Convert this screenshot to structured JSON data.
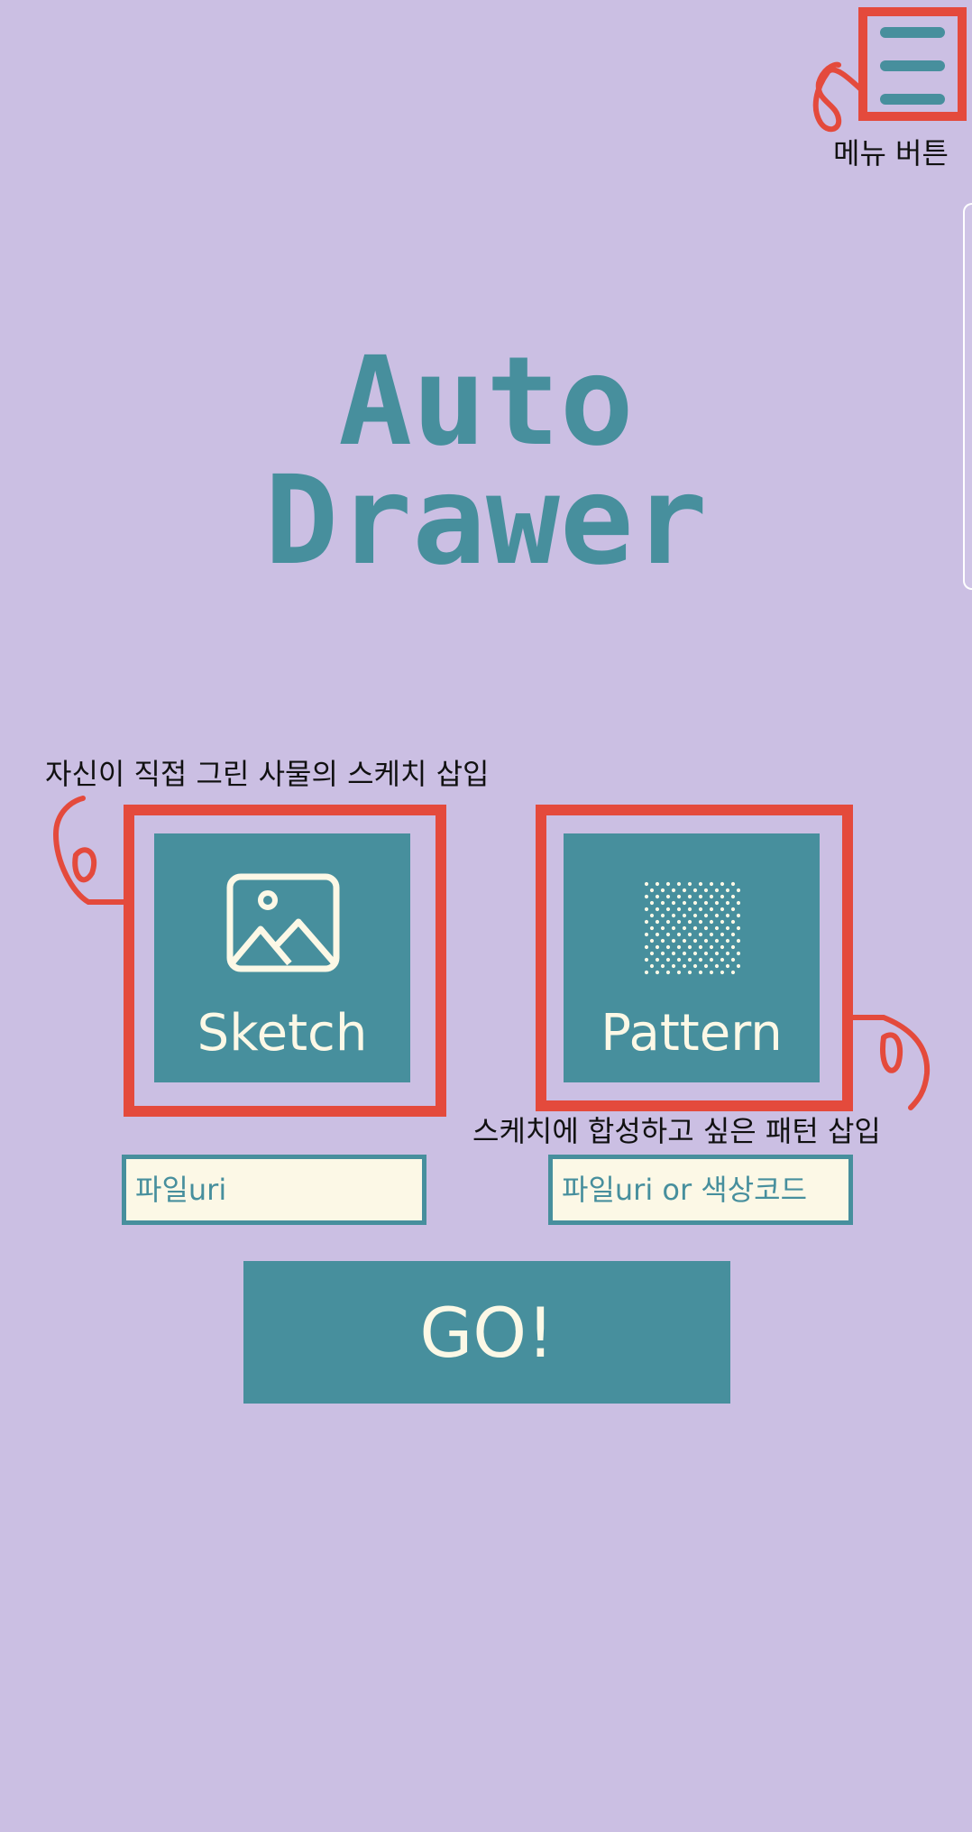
{
  "app": {
    "title_line1": "Auto",
    "title_line2": "Drawer"
  },
  "header": {
    "menu_icon": "hamburger-menu-icon",
    "menu_annotation": "메뉴 버튼"
  },
  "sketch": {
    "label": "Sketch",
    "icon": "image-icon",
    "annotation": "자신이 직접 그린 사물의 스케치 삽입",
    "input_placeholder": "파일uri"
  },
  "pattern": {
    "label": "Pattern",
    "icon": "dot-pattern-icon",
    "annotation": "스케치에 합성하고 싶은 패턴 삽입",
    "input_placeholder": "파일uri or 색상코드"
  },
  "actions": {
    "go_label": "GO!"
  },
  "colors": {
    "background": "#cbbfe3",
    "teal": "#478f9d",
    "cream": "#fcf8e6",
    "annotation_red": "#e44a3c"
  }
}
